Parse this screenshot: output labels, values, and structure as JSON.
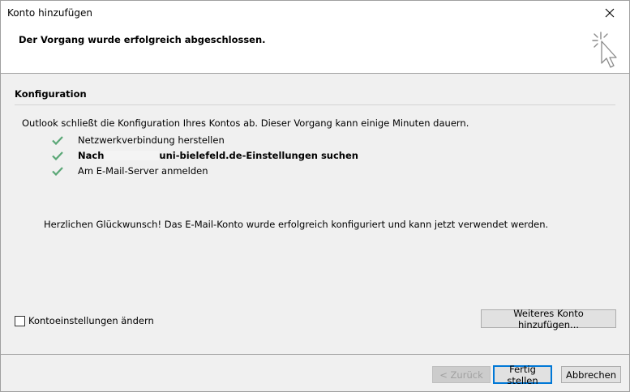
{
  "window": {
    "title": "Konto hinzufügen"
  },
  "header": {
    "message": "Der Vorgang wurde erfolgreich abgeschlossen."
  },
  "config": {
    "title": "Konfiguration",
    "intro": "Outlook schließt die Konfiguration Ihres Kontos ab. Dieser Vorgang kann einige Minuten dauern.",
    "steps": [
      {
        "label": "Netzwerkverbindung herstellen",
        "status": "done"
      },
      {
        "prefix": "Nach ",
        "suffix": "uni-bielefeld.de-Einstellungen suchen",
        "status": "done"
      },
      {
        "label": "Am E-Mail-Server anmelden",
        "status": "done"
      }
    ],
    "congrats": "Herzlichen Glückwunsch! Das E-Mail-Konto wurde erfolgreich konfiguriert und kann jetzt verwendet werden."
  },
  "options": {
    "change_settings_label": "Kontoeinstellungen ändern",
    "change_settings_checked": false,
    "add_another_label": "Weiteres Konto hinzufügen..."
  },
  "footer": {
    "back_label": "< Zurück",
    "finish_label": "Fertig stellen",
    "cancel_label": "Abbrechen"
  },
  "colors": {
    "check": "#5aa776",
    "accent": "#0078d7"
  }
}
